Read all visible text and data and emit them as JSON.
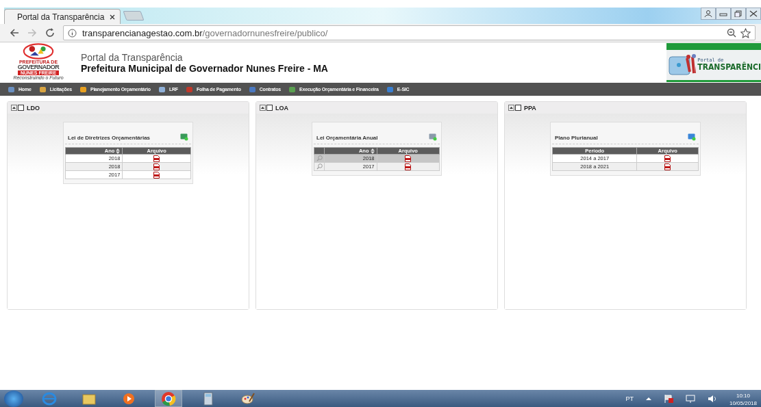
{
  "browser": {
    "tab_title": "Portal da Transparência",
    "url_host": "transparencianagestao.com.br",
    "url_path": "/governadornunesfreire/publico/"
  },
  "header": {
    "logo_texts": [
      "PREFEITURA DE",
      "GOVERNADOR",
      "NUNES FREIRE",
      "Reconstruindo o Futuro"
    ],
    "title": "Portal da Transparência",
    "subtitle": "Prefeitura Municipal de Governador Nunes Freire - MA",
    "badge_small": "Portal de",
    "badge_big": "TRANSPARÊNCI"
  },
  "menu": [
    {
      "label": "Home"
    },
    {
      "label": "Licitações"
    },
    {
      "label": "Planejamento Orçamentário"
    },
    {
      "label": "LRF"
    },
    {
      "label": "Folha de Pagamento"
    },
    {
      "label": "Contratos"
    },
    {
      "label": "Execução Orçamentária e Financeira"
    },
    {
      "label": "E-SIC"
    }
  ],
  "panels": [
    {
      "title": "LDO",
      "kind": "plain",
      "card_title": "Lei de Diretrizes Orçamentárias",
      "columns": [
        {
          "label": "Ano",
          "sortable": true
        },
        {
          "label": "Arquivo",
          "sortable": false
        }
      ],
      "rows": [
        {
          "value": "2018",
          "selected": false
        },
        {
          "value": "2018",
          "selected": false
        },
        {
          "value": "2017",
          "selected": false
        }
      ]
    },
    {
      "title": "LOA",
      "kind": "view",
      "card_title": "Lei Orçamentária Anual",
      "columns": [
        {
          "label": "Ano",
          "sortable": true
        },
        {
          "label": "Arquivo",
          "sortable": false
        }
      ],
      "rows": [
        {
          "value": "2018",
          "selected": true
        },
        {
          "value": "2017",
          "selected": false
        }
      ]
    },
    {
      "title": "PPA",
      "kind": "plain",
      "card_title": "Plano Plurianual",
      "columns": [
        {
          "label": "Período",
          "sortable": false
        },
        {
          "label": "Arquivo",
          "sortable": false
        }
      ],
      "rows": [
        {
          "value": "2014 a 2017",
          "selected": false
        },
        {
          "value": "2018 a 2021",
          "selected": false
        }
      ]
    }
  ],
  "taskbar": {
    "language": "PT",
    "time": "10:10",
    "date": "10/05/2018"
  }
}
